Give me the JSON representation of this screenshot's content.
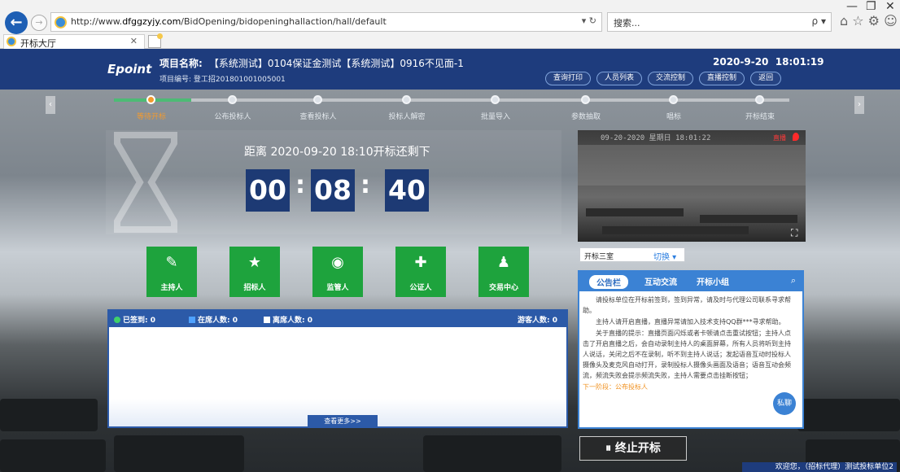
{
  "browser": {
    "back_icon": "back-arrow-icon",
    "forward_icon": "forward-arrow-icon",
    "url_prefix": "http://www.",
    "url_domain": "dfggzyjy.com",
    "url_path": "/BidOpening/bidopeninghallaction/hall/default",
    "refresh": "▾ ↻",
    "search_placeholder": "搜索...",
    "search_icon": "ρ ▾",
    "home_fav_settings": "⌂ ☆ ⚙ ☺",
    "minimize": "—",
    "restore": "❐",
    "close": "✕"
  },
  "tab": {
    "title": "开标大厅",
    "close": "✕"
  },
  "header": {
    "logo": "Epoint",
    "project_label": "项目名称:",
    "project_name": "【系统测试】0104保证金测试【系统测试】0916不见面-1",
    "project_no": "项目编号: 登工招201801001005001",
    "date": "2020-9-20",
    "time": "18:01:19",
    "buttons": [
      "查询打印",
      "人员列表",
      "交流控制",
      "直播控制",
      "返回"
    ]
  },
  "steps": [
    {
      "label": "等待开标",
      "active": true
    },
    {
      "label": "公布投标人",
      "active": false
    },
    {
      "label": "查看投标人",
      "active": false
    },
    {
      "label": "投标人解密",
      "active": false
    },
    {
      "label": "批量导入",
      "active": false
    },
    {
      "label": "参数抽取",
      "active": false
    },
    {
      "label": "唱标",
      "active": false
    },
    {
      "label": "开标结束",
      "active": false
    }
  ],
  "countdown": {
    "text": "距离 2020-09-20 18:10开标还剩下",
    "hh": "00",
    "mm": "08",
    "ss": "40",
    "sep": ":"
  },
  "video": {
    "stamp": "09-20-2020 星期日 18:01:22",
    "rec": "直播",
    "fullscreen": "⛶"
  },
  "room": {
    "name": "开标三室",
    "switch": "切换 ▾"
  },
  "roles": [
    {
      "label": "主持人",
      "icon": "host-icon",
      "glyph": "✎"
    },
    {
      "label": "招标人",
      "icon": "tenderer-icon",
      "glyph": "★"
    },
    {
      "label": "监管人",
      "icon": "supervisor-icon",
      "glyph": "◉"
    },
    {
      "label": "公证人",
      "icon": "notary-icon",
      "glyph": "✚"
    },
    {
      "label": "交易中心",
      "icon": "trade-center-icon",
      "glyph": "♟"
    }
  ],
  "attendance": {
    "signed": "已签到: 0",
    "present": "在席人数: 0",
    "absent": "离席人数: 0",
    "visitors": "游客人数: 0",
    "more": "查看更多>>"
  },
  "notice": {
    "tabs": [
      "公告栏",
      "互动交流",
      "开标小组"
    ],
    "paragraphs": [
      "请投标单位在开标前签到，签到异常，请及时与代理公司联系寻求帮助。",
      "主持人请开启直播，直播异常请加入技术支持QQ群***寻求帮助。",
      "关于直播的提示：直播页面闪烁或者卡顿请点击重试按钮；主持人点击了开启直播之后，会自动录制主持人的桌面屏幕，所有人员将听到主持人说话，关闭之后不在录制，听不到主持人说话；发起语音互动时投标人摄像头及麦克风自动打开，录制投标人摄像头画面及语音；语音互动会频流，频流失败会提示频流失败，主持人需要点击挂断按钮；"
    ],
    "next": "下一阶段：公布投标人",
    "chat": "私聊"
  },
  "actions": {
    "stop": "⏸ 终止开标"
  },
  "footer": {
    "welcome": "欢迎您，（招标代理）测试投标单位2"
  },
  "colors": {
    "header": "#1e3c7d",
    "accent": "#3b82d4",
    "tile": "#1ea33d",
    "step_active": "#f39a2e"
  }
}
